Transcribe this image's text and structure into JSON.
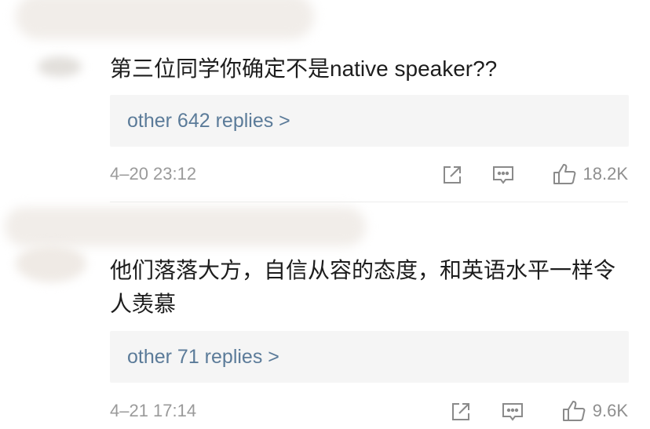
{
  "comments": [
    {
      "text": "第三位同学你确定不是native speaker??",
      "replies_link": "other 642 replies >",
      "timestamp": "4–20 23:12",
      "likes": "18.2K"
    },
    {
      "text": "他们落落大方，自信从容的态度，和英语水平一样令人羡慕",
      "replies_link": "other 71 replies >",
      "timestamp": "4–21 17:14",
      "likes": "9.6K"
    }
  ],
  "icons": {
    "share": "share-icon",
    "comment": "comment-icon",
    "like": "thumbs-up-icon"
  },
  "colors": {
    "link": "#5b7b99",
    "meta": "#9a9a9a",
    "reply_bg": "#f5f5f5",
    "redaction": "#f1ede9"
  }
}
